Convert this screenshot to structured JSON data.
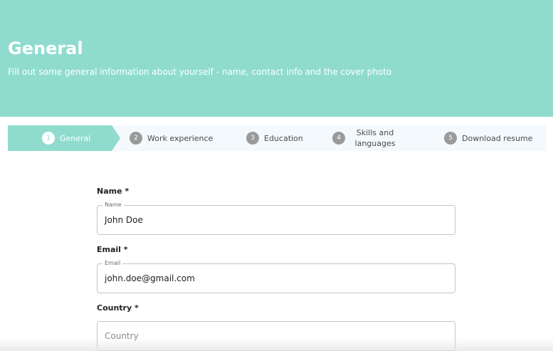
{
  "header": {
    "title": "General",
    "subtitle": "Fill out some general information about yourself - name, contact info and the cover photo"
  },
  "stepper": {
    "steps": [
      {
        "number": "1",
        "label": "General"
      },
      {
        "number": "2",
        "label": "Work experience"
      },
      {
        "number": "3",
        "label": "Education"
      },
      {
        "number": "4",
        "label": "Skills and languages"
      },
      {
        "number": "5",
        "label": "Download resume"
      }
    ],
    "active_index": 0
  },
  "form": {
    "name": {
      "label": "Name *",
      "legend": "Name",
      "value": "John Doe"
    },
    "email": {
      "label": "Email *",
      "legend": "Email",
      "value": "john.doe@gmail.com"
    },
    "country": {
      "label": "Country *",
      "placeholder": "Country",
      "value": ""
    }
  },
  "colors": {
    "accent": "#8fdccf",
    "stepper_bg": "#f3f9fc",
    "step_circle": "#9a9a9a"
  }
}
